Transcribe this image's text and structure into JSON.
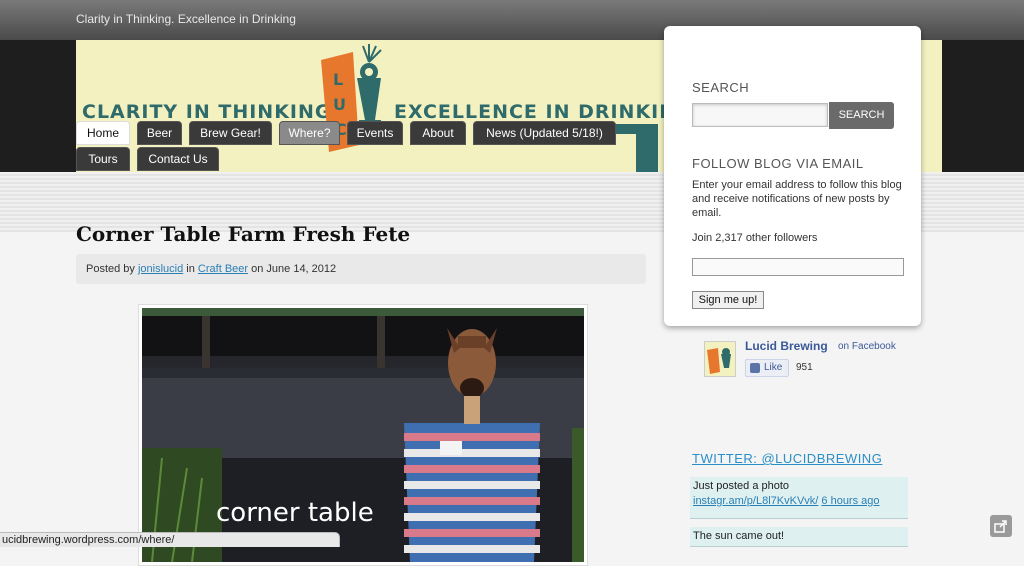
{
  "header": {
    "tagline": "Clarity in Thinking. Excellence in Drinking",
    "banner_left": "CLARITY IN THINKING",
    "banner_right": "EXCELLENCE IN DRINKING",
    "logo_icon": "lucid-logo-icon"
  },
  "nav": {
    "items": [
      {
        "label": "Home"
      },
      {
        "label": "Beer"
      },
      {
        "label": "Brew Gear!"
      },
      {
        "label": "Where?"
      },
      {
        "label": "Events"
      },
      {
        "label": "About"
      },
      {
        "label": "News (Updated 5/18!)"
      },
      {
        "label": "Tours"
      },
      {
        "label": "Contact Us"
      }
    ],
    "active": "Home",
    "hovered": "Where?"
  },
  "post": {
    "title": "Corner Table Farm Fresh Fete",
    "posted_by": "Posted by",
    "author": "jonislucid",
    "in": "in",
    "category": "Craft Beer",
    "on": "on June 14, 2012",
    "photo_caption": "corner table"
  },
  "sidebar": {
    "search_heading": "SEARCH",
    "search_button": "SEARCH",
    "search_value": "",
    "follow_heading": "FOLLOW BLOG VIA EMAIL",
    "follow_text": "Enter your email address to follow this blog and receive notifications of new posts by email.",
    "followers": "Join 2,317 other followers",
    "email_value": "",
    "signup_button": "Sign me up!",
    "facebook": {
      "name": "Lucid Brewing",
      "on": "on Facebook",
      "like": "Like",
      "count": "951"
    },
    "twitter_heading": "TWITTER: @LUCIDBREWING",
    "tweets": [
      {
        "text": "Just posted a photo",
        "link": "instagr.am/p/L8l7KvKVvk/",
        "time": "6 hours ago"
      },
      {
        "text": "The sun came out!"
      }
    ]
  },
  "status_url": "ucidbrewing.wordpress.com/where/",
  "colors": {
    "banner_bg": "#f3f1c0",
    "banner_text": "#2f6b6b",
    "logo_orange": "#e8772e",
    "link": "#2a7fb5",
    "facebook": "#3b5998"
  }
}
